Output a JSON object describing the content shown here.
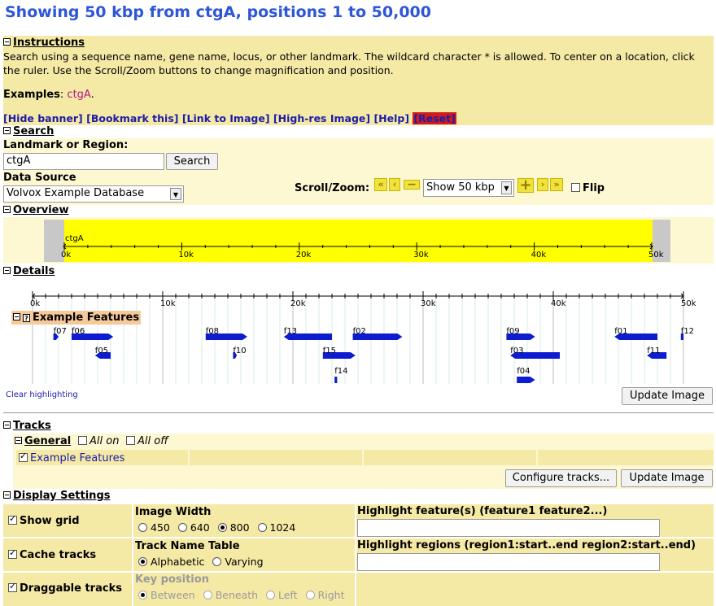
{
  "page": {
    "title": "Showing 50 kbp from ctgA, positions 1 to 50,000"
  },
  "instructions": {
    "header": "Instructions",
    "text_line1": "Search using a sequence name, gene name, locus, or other landmark. The wildcard character * is allowed. To center on a location, click",
    "text_line2": "the ruler. Use the Scroll/Zoom buttons to change magnification and position.",
    "examples_label": "Examples",
    "example_link": "ctgA",
    "links": [
      "[Hide banner]",
      "[Bookmark this]",
      "[Link to Image]",
      "[High-res Image]",
      "[Help]"
    ],
    "reset_label": "[Reset]"
  },
  "search": {
    "header": "Search",
    "landmark_label": "Landmark or Region",
    "landmark_value": "ctgA",
    "search_button": "Search",
    "data_source_label": "Data Source",
    "data_source_value": "Volvox Example Database",
    "scroll_zoom_label": "Scroll/Zoom:",
    "zoom_value": "Show 50 kbp",
    "flip_label": "Flip"
  },
  "overview": {
    "header": "Overview",
    "contig_label": "ctgA",
    "ticks": [
      "0k",
      "10k",
      "20k",
      "30k",
      "40k",
      "50k"
    ]
  },
  "details": {
    "header": "Details",
    "ticks": [
      "0k",
      "10k",
      "20k",
      "30k",
      "40k",
      "50k"
    ],
    "track_label": "Example Features",
    "features": [
      {
        "name": "f07",
        "start": 1600,
        "end": 2000,
        "row": 0,
        "strand": 1
      },
      {
        "name": "f06",
        "start": 3000,
        "end": 6200,
        "row": 0,
        "strand": 1
      },
      {
        "name": "f08",
        "start": 13300,
        "end": 16500,
        "row": 0,
        "strand": 1
      },
      {
        "name": "f13",
        "start": 19300,
        "end": 23000,
        "row": 0,
        "strand": -1
      },
      {
        "name": "f02",
        "start": 24600,
        "end": 28400,
        "row": 0,
        "strand": 1
      },
      {
        "name": "f09",
        "start": 36400,
        "end": 38600,
        "row": 0,
        "strand": 1
      },
      {
        "name": "f01",
        "start": 44700,
        "end": 48000,
        "row": 0,
        "strand": -1
      },
      {
        "name": "f12",
        "start": 49800,
        "end": 50000,
        "row": 0,
        "strand": 1
      },
      {
        "name": "f05",
        "start": 4800,
        "end": 6000,
        "row": 1,
        "strand": -1
      },
      {
        "name": "f10",
        "start": 15400,
        "end": 15700,
        "row": 1,
        "strand": 1
      },
      {
        "name": "f15",
        "start": 22300,
        "end": 24800,
        "row": 1,
        "strand": 1
      },
      {
        "name": "f03",
        "start": 36700,
        "end": 40500,
        "row": 1,
        "strand": -1
      },
      {
        "name": "f11",
        "start": 47200,
        "end": 48700,
        "row": 1,
        "strand": -1
      },
      {
        "name": "f14",
        "start": 23200,
        "end": 23400,
        "row": 2,
        "strand": 1
      },
      {
        "name": "f04",
        "start": 37200,
        "end": 38600,
        "row": 3,
        "strand": 1
      }
    ],
    "clear_highlighting": "Clear highlighting",
    "update_image": "Update Image"
  },
  "tracks": {
    "header": "Tracks",
    "group_label": "General",
    "all_on": "All on",
    "all_off": "All off",
    "track_item": "Example Features",
    "configure_button": "Configure tracks...",
    "update_image": "Update Image"
  },
  "display": {
    "header": "Display Settings",
    "show_grid": "Show grid",
    "cache_tracks": "Cache tracks",
    "draggable_tracks": "Draggable tracks",
    "image_width_label": "Image Width",
    "image_widths": [
      "450",
      "640",
      "800",
      "1024"
    ],
    "image_width_selected": "800",
    "track_name_table_label": "Track Name Table",
    "track_name_options": [
      "Alphabetic",
      "Varying"
    ],
    "key_position_label": "Key position",
    "key_position_options": [
      "Between",
      "Beneath",
      "Left",
      "Right"
    ],
    "highlight_features_label": "Highlight feature(s) (feature1 feature2...)",
    "highlight_regions_label": "Highlight regions (region1:start..end region2:start..end)"
  },
  "colors": {
    "title": "#2d56d8",
    "feature": "#0d1bd1",
    "overview_fill": "#ffff00",
    "band": "#f5e9a6",
    "reset_bg": "#d11a1a"
  }
}
